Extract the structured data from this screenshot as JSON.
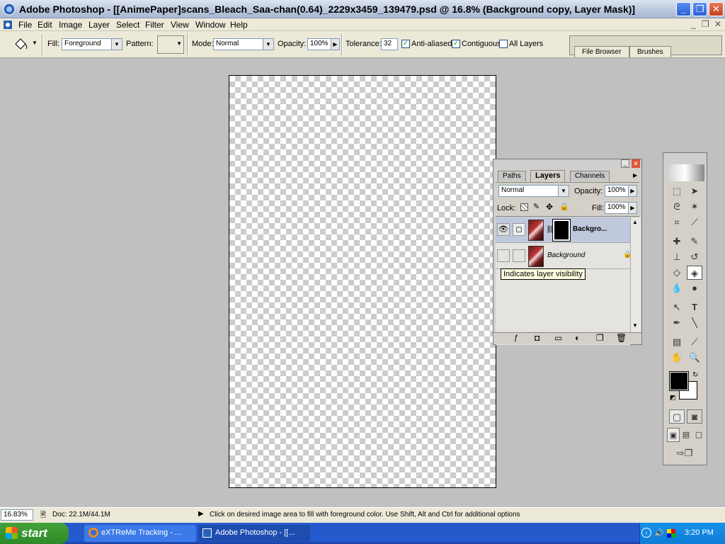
{
  "window": {
    "title": "Adobe Photoshop - [[AnimePaper]scans_Bleach_Saa-chan(0.64)_2229x3459_139479.psd @ 16.8% (Background copy, Layer Mask)]",
    "minimize": "_",
    "maximize": "❐",
    "close": "✕"
  },
  "menubar": {
    "items": [
      "File",
      "Edit",
      "Image",
      "Layer",
      "Select",
      "Filter",
      "View",
      "Window",
      "Help"
    ],
    "doc_controls": [
      "_",
      "❐",
      "✕"
    ]
  },
  "options": {
    "fill_label": "Fill:",
    "fill_value": "Foreground",
    "pattern_label": "Pattern:",
    "mode_label": "Mode:",
    "mode_value": "Normal",
    "opacity_label": "Opacity:",
    "opacity_value": "100%",
    "tolerance_label": "Tolerance:",
    "tolerance_value": "32",
    "anti_aliased_label": "Anti-aliased",
    "anti_aliased_checked": true,
    "contiguous_label": "Contiguous",
    "contiguous_checked": true,
    "all_layers_label": "All Layers",
    "all_layers_checked": false,
    "palette_well_tabs": [
      "File Browser",
      "Brushes"
    ]
  },
  "layers_palette": {
    "tabs": [
      "Paths",
      "Layers",
      "Channels"
    ],
    "active_tab": "Layers",
    "blend_mode": "Normal",
    "opacity_label": "Opacity:",
    "opacity_value": "100%",
    "lock_label": "Lock:",
    "fill_label": "Fill:",
    "fill_value": "100%",
    "layers": [
      {
        "name": "Backgro...",
        "visible": true,
        "selected": true,
        "has_mask": true
      },
      {
        "name": "Background",
        "visible": false,
        "selected": false,
        "locked": true
      }
    ],
    "tooltip": "Indicates layer visibility"
  },
  "statusbar": {
    "zoom": "16.83%",
    "doc": "Doc: 22.1M/44.1M",
    "hint": "Click on desired image area to fill with foreground color.  Use Shift, Alt and Ctrl for additional options"
  },
  "taskbar": {
    "start_label": "start",
    "buttons": [
      {
        "label": "eXTReMe Tracking - ...",
        "active": false
      },
      {
        "label": "Adobe Photoshop - [[...",
        "active": true
      }
    ],
    "clock": "3:20 PM"
  }
}
